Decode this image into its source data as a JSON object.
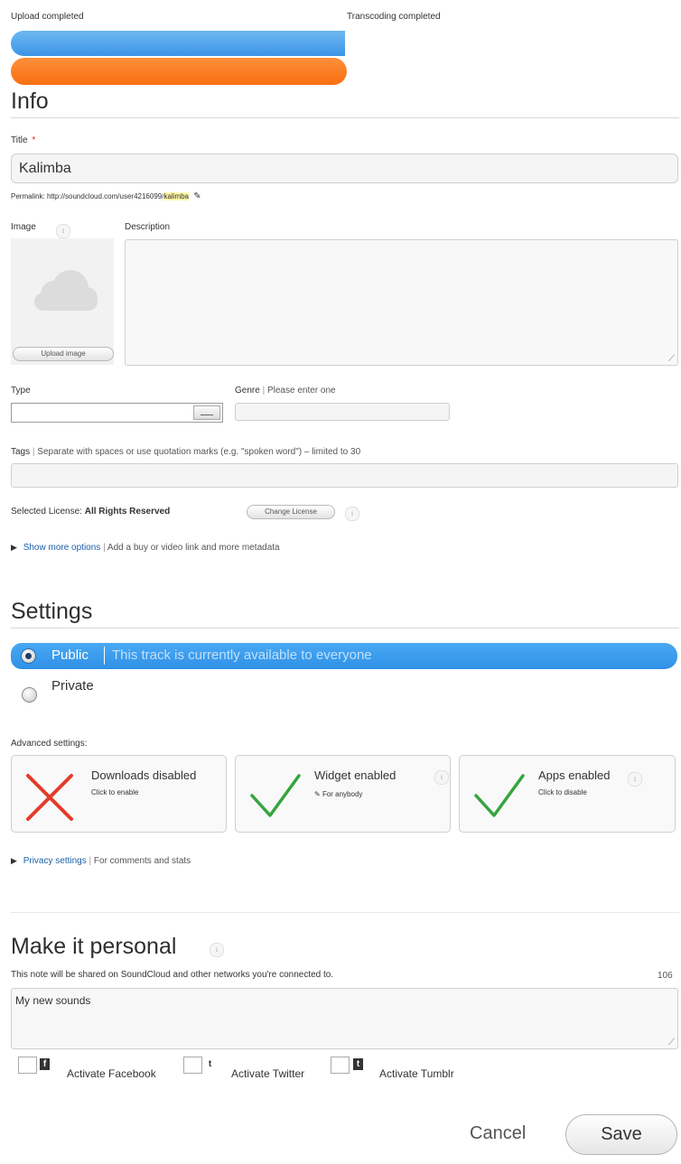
{
  "upload": {
    "upload_label": "Upload completed",
    "transcoding_label": "Transcoding completed",
    "upload_progress": 1.0,
    "transcoding_progress": 1.0,
    "upload_color": "#4aa6ef",
    "transcoding_color": "#ff7a1a"
  },
  "info": {
    "heading": "Info",
    "title_label": "Title",
    "required_marker": "*",
    "title_value": "Kalimba",
    "permalink_prefix": "Permalink: http://soundcloud.com/user4216099/",
    "permalink_slug": "kalimba",
    "image_label": "Image",
    "upload_image_label": "Upload image",
    "description_label": "Description",
    "description_value": "",
    "type_label": "Type",
    "type_value": "",
    "genre_label": "Genre",
    "genre_hint": "Please enter one",
    "genre_value": "",
    "tags_label": "Tags",
    "tags_hint": "Separate with spaces or use quotation marks (e.g. \"spoken word\") – limited to 30",
    "tags_value": "",
    "license_prefix": "Selected License:",
    "license_value": "All Rights Reserved",
    "change_license_label": "Change License",
    "more_options_link": "Show more options",
    "more_options_hint": "Add a buy or video link and more metadata"
  },
  "settings": {
    "heading": "Settings",
    "public_label": "Public",
    "public_hint": "This track is currently available to everyone",
    "private_label": "Private",
    "selected": "Public",
    "accent": "#3a9ced",
    "advanced_label": "Advanced settings:",
    "cards": [
      {
        "title": "Downloads disabled",
        "sub": "Click to enable",
        "icon": "cross-icon"
      },
      {
        "title": "Widget enabled",
        "sub": "For anybody",
        "icon": "check-icon"
      },
      {
        "title": "Apps enabled",
        "sub": "Click to disable",
        "icon": "check-icon"
      }
    ],
    "privacy_link": "Privacy settings",
    "privacy_hint": "For comments and stats"
  },
  "personal": {
    "heading": "Make it personal",
    "note_label": "This note will be shared on SoundCloud and other networks you're connected to.",
    "char_count": "106",
    "note_value": "My new sounds",
    "facebook_label": "Activate Facebook",
    "twitter_label": "Activate Twitter",
    "tumblr_label": "Activate Tumblr",
    "facebook_glyph": "f",
    "twitter_glyph": "t",
    "tumblr_glyph": "t"
  },
  "actions": {
    "cancel_label": "Cancel",
    "save_label": "Save"
  }
}
